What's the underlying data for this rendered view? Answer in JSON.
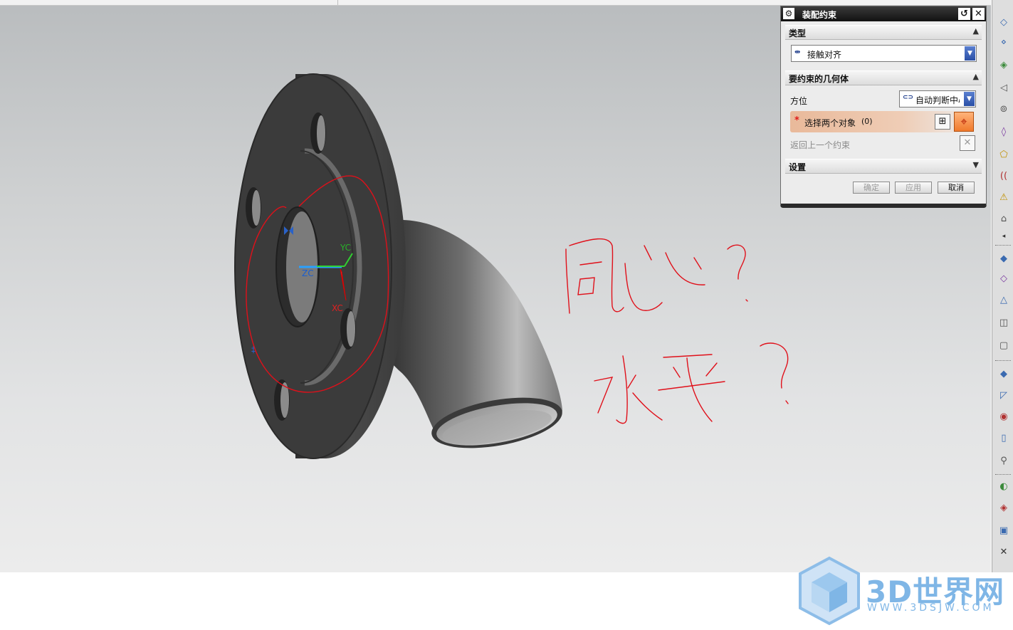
{
  "dialog": {
    "title": "装配约束",
    "reset_icon": "reset-icon",
    "close_icon": "close-icon",
    "type_section": {
      "label": "类型",
      "value": "接触对齐"
    },
    "geometry_section": {
      "label": "要约束的几何体",
      "orientation_label": "方位",
      "orientation_value": "自动判断中心",
      "select_label": "选择两个对象",
      "select_count": "(0)",
      "return_label": "返回上一个约束"
    },
    "settings_section": {
      "label": "设置"
    },
    "buttons": {
      "ok": "确定",
      "apply": "应用",
      "cancel": "取消"
    }
  },
  "viewport": {
    "triad": {
      "x": "XC",
      "y": "YC",
      "z": "ZC"
    },
    "annotations": [
      "同心？",
      "水平？"
    ]
  },
  "watermark": {
    "brand": "3D世界网",
    "url": "WWW.3DSJW.COM"
  },
  "colors": {
    "annotation": "#e0101a",
    "accent": "#f07a2c",
    "watermark": "#7fb6e6"
  }
}
